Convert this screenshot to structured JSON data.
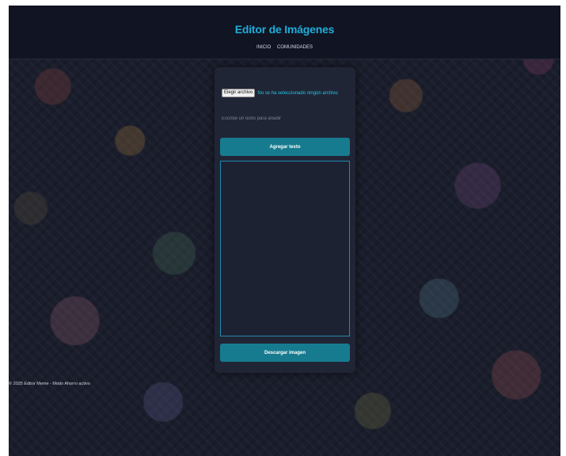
{
  "header": {
    "title": "Editor de Imágenes",
    "nav": [
      "INICIO",
      "COMUNIDADES"
    ]
  },
  "editor": {
    "file_button_label": "Elegir archivo",
    "file_status": "No se ha seleccionado ningún archivo",
    "text_placeholder": "Escribe un texto para añadir",
    "add_text_label": "Agregar texto",
    "download_label": "Descargar imagen"
  },
  "footer": {
    "text": "© 2025 Editor Meme - Modo Ahorro activo"
  },
  "colors": {
    "accent": "#1eaedb",
    "button": "#177b8f",
    "panel": "#202536",
    "header": "#111422"
  }
}
